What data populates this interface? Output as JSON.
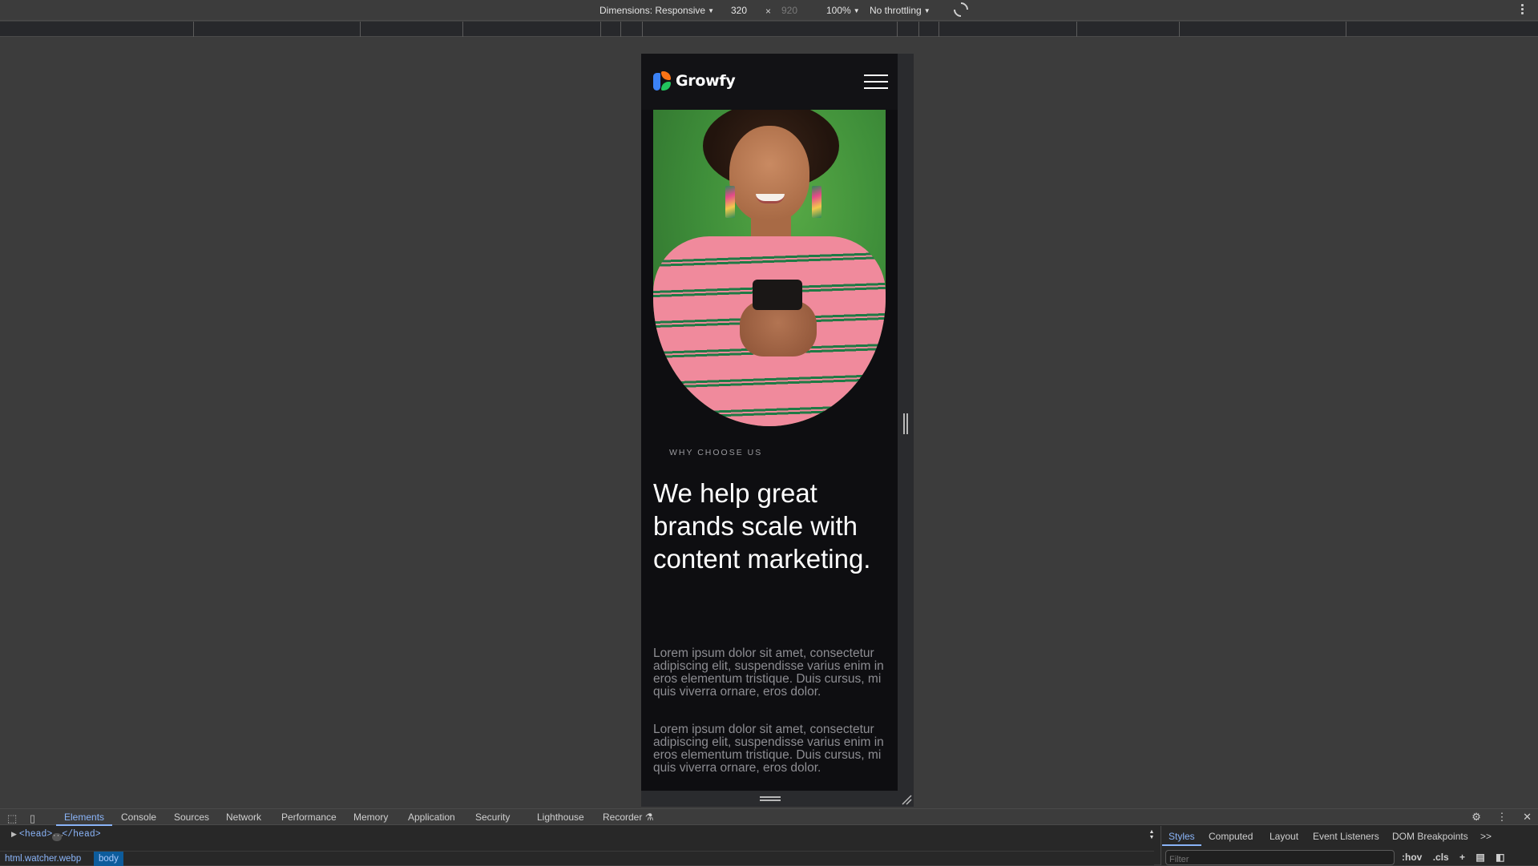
{
  "device_toolbar": {
    "dimensions_label": "Dimensions: Responsive",
    "width": "320",
    "times": "×",
    "height": "920",
    "zoom": "100%",
    "throttling": "No throttling",
    "rotate_icon": "rotate-icon",
    "more_icon": "kebab-menu-icon"
  },
  "site": {
    "brand": "Growfy",
    "logo_colors": {
      "blue": "#3b82f6",
      "orange": "#f97316",
      "green": "#22c55e"
    },
    "menu_icon": "hamburger-icon",
    "hero_image_alt": "Smiling woman in pink striped sweater looking at her phone against green background",
    "eyebrow": "WHY CHOOSE US",
    "headline": "We help great brands scale with content marketing.",
    "paragraphs": [
      "Lorem ipsum dolor sit amet, consectetur adipiscing elit, suspendisse varius enim in eros elementum tristique. Duis cursus, mi quis viverra ornare, eros dolor.",
      "Lorem ipsum dolor sit amet, consectetur adipiscing elit, suspendisse varius enim in eros elementum tristique. Duis cursus, mi quis viverra ornare, eros dolor."
    ]
  },
  "devtools": {
    "tabs": [
      {
        "label": "Elements",
        "active": true
      },
      {
        "label": "Console"
      },
      {
        "label": "Sources"
      },
      {
        "label": "Network"
      },
      {
        "label": "Performance"
      },
      {
        "label": "Memory"
      },
      {
        "label": "Application"
      },
      {
        "label": "Security"
      },
      {
        "label": "Lighthouse"
      },
      {
        "label": "Recorder"
      }
    ],
    "dom_line": {
      "open": "<head>",
      "close": "</head>"
    },
    "breadcrumbs": [
      "html.watcher.webp",
      "body"
    ],
    "side_tabs": [
      {
        "label": "Styles",
        "active": true
      },
      {
        "label": "Computed"
      },
      {
        "label": "Layout"
      },
      {
        "label": "Event Listeners"
      },
      {
        "label": "DOM Breakpoints"
      },
      {
        "label": ">>"
      }
    ],
    "filter_placeholder": "Filter",
    "filter_tools": [
      ":hov",
      ".cls",
      "+"
    ],
    "accent_color": "#8ab4f8"
  }
}
